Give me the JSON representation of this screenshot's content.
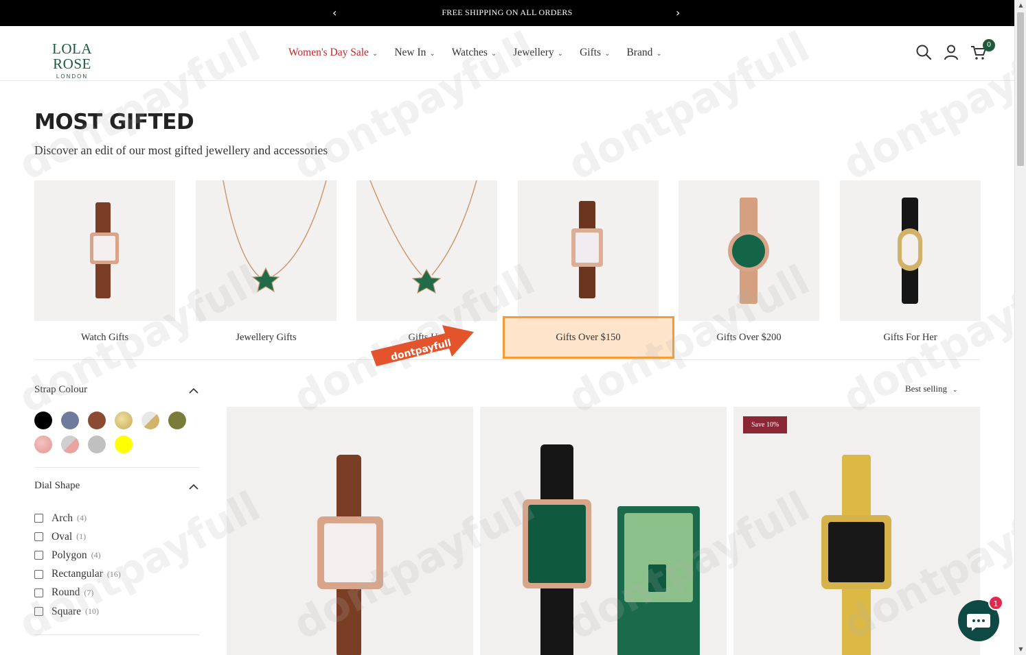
{
  "announcement": {
    "text": "FREE SHIPPING ON ALL ORDERS",
    "prev": "‹",
    "next": "›"
  },
  "logo": {
    "line1": "LOLA ROSE",
    "line2": "LONDON"
  },
  "nav": [
    {
      "label": "Women's Day Sale",
      "sale": true
    },
    {
      "label": "New In"
    },
    {
      "label": "Watches"
    },
    {
      "label": "Jewellery"
    },
    {
      "label": "Gifts"
    },
    {
      "label": "Brand"
    }
  ],
  "header_icons": {
    "search": "search-icon",
    "account": "user-icon",
    "cart": "cart-icon",
    "cart_count": "0"
  },
  "page": {
    "title": "MOST GIFTED",
    "subtitle": "Discover an edit of our most gifted jewellery and accessories"
  },
  "categories": [
    {
      "label": "Watch Gifts"
    },
    {
      "label": "Jewellery Gifts"
    },
    {
      "label": "Gifts U..."
    },
    {
      "label": "Gifts Over $150",
      "highlighted": true
    },
    {
      "label": "Gifts Over $200"
    },
    {
      "label": "Gifts For Her"
    }
  ],
  "promo_arrow": {
    "text": "dontpayfull"
  },
  "filters": {
    "strap_colour": {
      "title": "Strap Colour",
      "colors": [
        "#000000",
        "#6e7b9a",
        "#8a4b32",
        "#d8c27a",
        "#c8c2b0",
        "#7a7d3a",
        "#e9a3a0",
        "#d6cfd0",
        "#c0c0c0",
        "#ffff00"
      ]
    },
    "dial_shape": {
      "title": "Dial Shape",
      "options": [
        {
          "name": "Arch",
          "count": "(4)"
        },
        {
          "name": "Oval",
          "count": "(1)"
        },
        {
          "name": "Polygon",
          "count": "(4)"
        },
        {
          "name": "Rectangular",
          "count": "(16)"
        },
        {
          "name": "Round",
          "count": "(7)"
        },
        {
          "name": "Square",
          "count": "(10)"
        }
      ]
    }
  },
  "sort": {
    "label": "Best selling"
  },
  "products": [
    {
      "badge": ""
    },
    {
      "badge": ""
    },
    {
      "badge": "Save 10%"
    }
  ],
  "chat": {
    "unread": "1"
  },
  "watermark": "dontpayfull"
}
